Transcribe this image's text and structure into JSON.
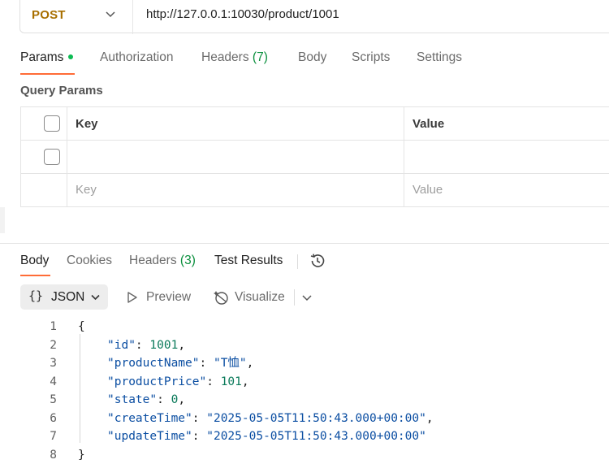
{
  "request": {
    "method": "POST",
    "url": "http://127.0.0.1:10030/product/1001"
  },
  "request_tabs": {
    "params": "Params",
    "authorization": "Authorization",
    "headers": "Headers",
    "headers_count": "(7)",
    "body": "Body",
    "scripts": "Scripts",
    "settings": "Settings"
  },
  "query_params": {
    "title": "Query Params",
    "key_header": "Key",
    "value_header": "Value",
    "key_placeholder": "Key",
    "value_placeholder": "Value"
  },
  "response_tabs": {
    "body": "Body",
    "cookies": "Cookies",
    "headers": "Headers",
    "headers_count": "(3)",
    "test_results": "Test Results"
  },
  "format_bar": {
    "braces": "{}",
    "format": "JSON",
    "preview": "Preview",
    "visualize": "Visualize"
  },
  "code_lines": [
    {
      "n": "1",
      "text": "{"
    },
    {
      "n": "2",
      "key": "\"id\"",
      "value": "1001",
      "type": "num",
      "comma": ","
    },
    {
      "n": "3",
      "key": "\"productName\"",
      "value": "\"T恤\"",
      "type": "str",
      "comma": ","
    },
    {
      "n": "4",
      "key": "\"productPrice\"",
      "value": "101",
      "type": "num",
      "comma": ","
    },
    {
      "n": "5",
      "key": "\"state\"",
      "value": "0",
      "type": "num",
      "comma": ","
    },
    {
      "n": "6",
      "key": "\"createTime\"",
      "value": "\"2025-05-05T11:50:43.000+00:00\"",
      "type": "str",
      "comma": ","
    },
    {
      "n": "7",
      "key": "\"updateTime\"",
      "value": "\"2025-05-05T11:50:43.000+00:00\"",
      "type": "str",
      "comma": ""
    },
    {
      "n": "8",
      "text": "}"
    }
  ],
  "colors": {
    "accent": "#ff6c37",
    "method": "#a86f00",
    "active_dot": "#0cbb52",
    "count": "#0a8f3d"
  }
}
